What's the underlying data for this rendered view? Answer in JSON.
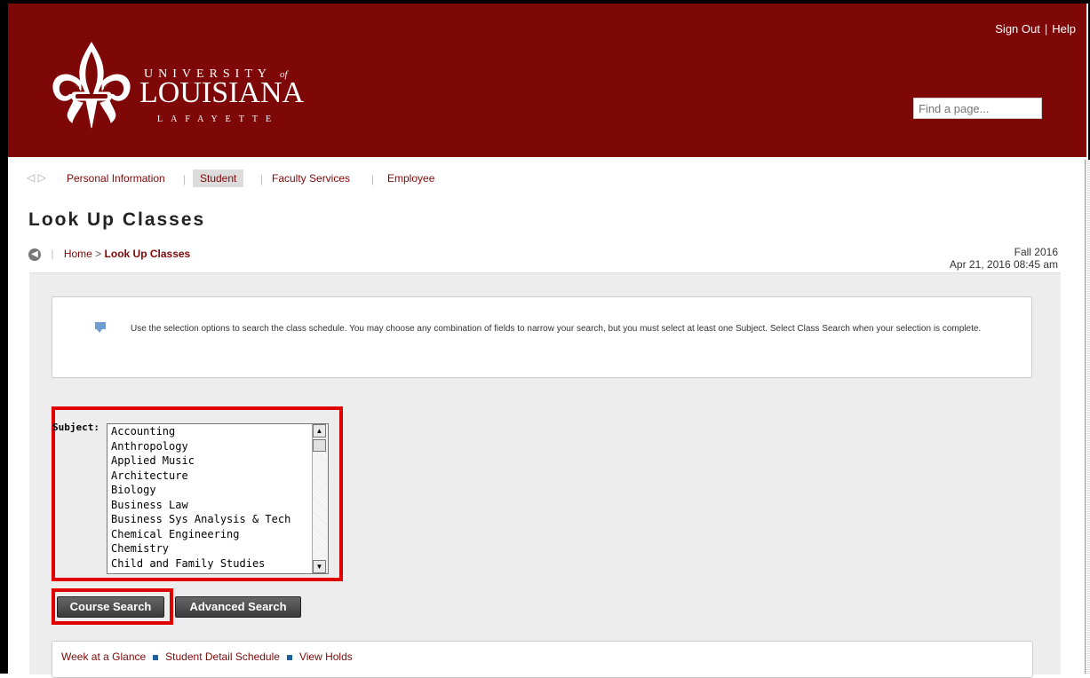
{
  "header": {
    "logo": {
      "univ_text": "UNIVERSITY",
      "of_text": "of",
      "name_text": "LOUISIANA",
      "sub_text": "LAFAYETTE"
    },
    "sign_out": "Sign Out",
    "help": "Help",
    "find_placeholder": "Find a page...",
    "bg_color": "#7e0808"
  },
  "nav": {
    "items": [
      "Personal Information",
      "Student",
      "Faculty Services",
      "Employee"
    ],
    "active": "Student"
  },
  "page": {
    "title": "Look Up Classes",
    "breadcrumb_home": "Home",
    "breadcrumb_sep": ">",
    "breadcrumb_current": "Look Up Classes",
    "term": "Fall 2016",
    "datetime": "Apr 21, 2016 08:45 am"
  },
  "info": {
    "text": "Use the selection options to search the class schedule. You may choose any combination of fields to narrow your search, but you must select at least one Subject. Select Class Search when your selection is complete."
  },
  "subject": {
    "label": "Subject:",
    "options": [
      "Accounting",
      "Anthropology",
      "Applied Music",
      "Architecture",
      "Biology",
      "Business Law",
      "Business Sys Analysis & Tech",
      "Chemical Engineering",
      "Chemistry",
      "Child and Family Studies"
    ]
  },
  "buttons": {
    "course_search": "Course Search",
    "advanced_search": "Advanced Search"
  },
  "links": [
    "Week at a Glance",
    "Student Detail Schedule",
    "View Holds"
  ]
}
